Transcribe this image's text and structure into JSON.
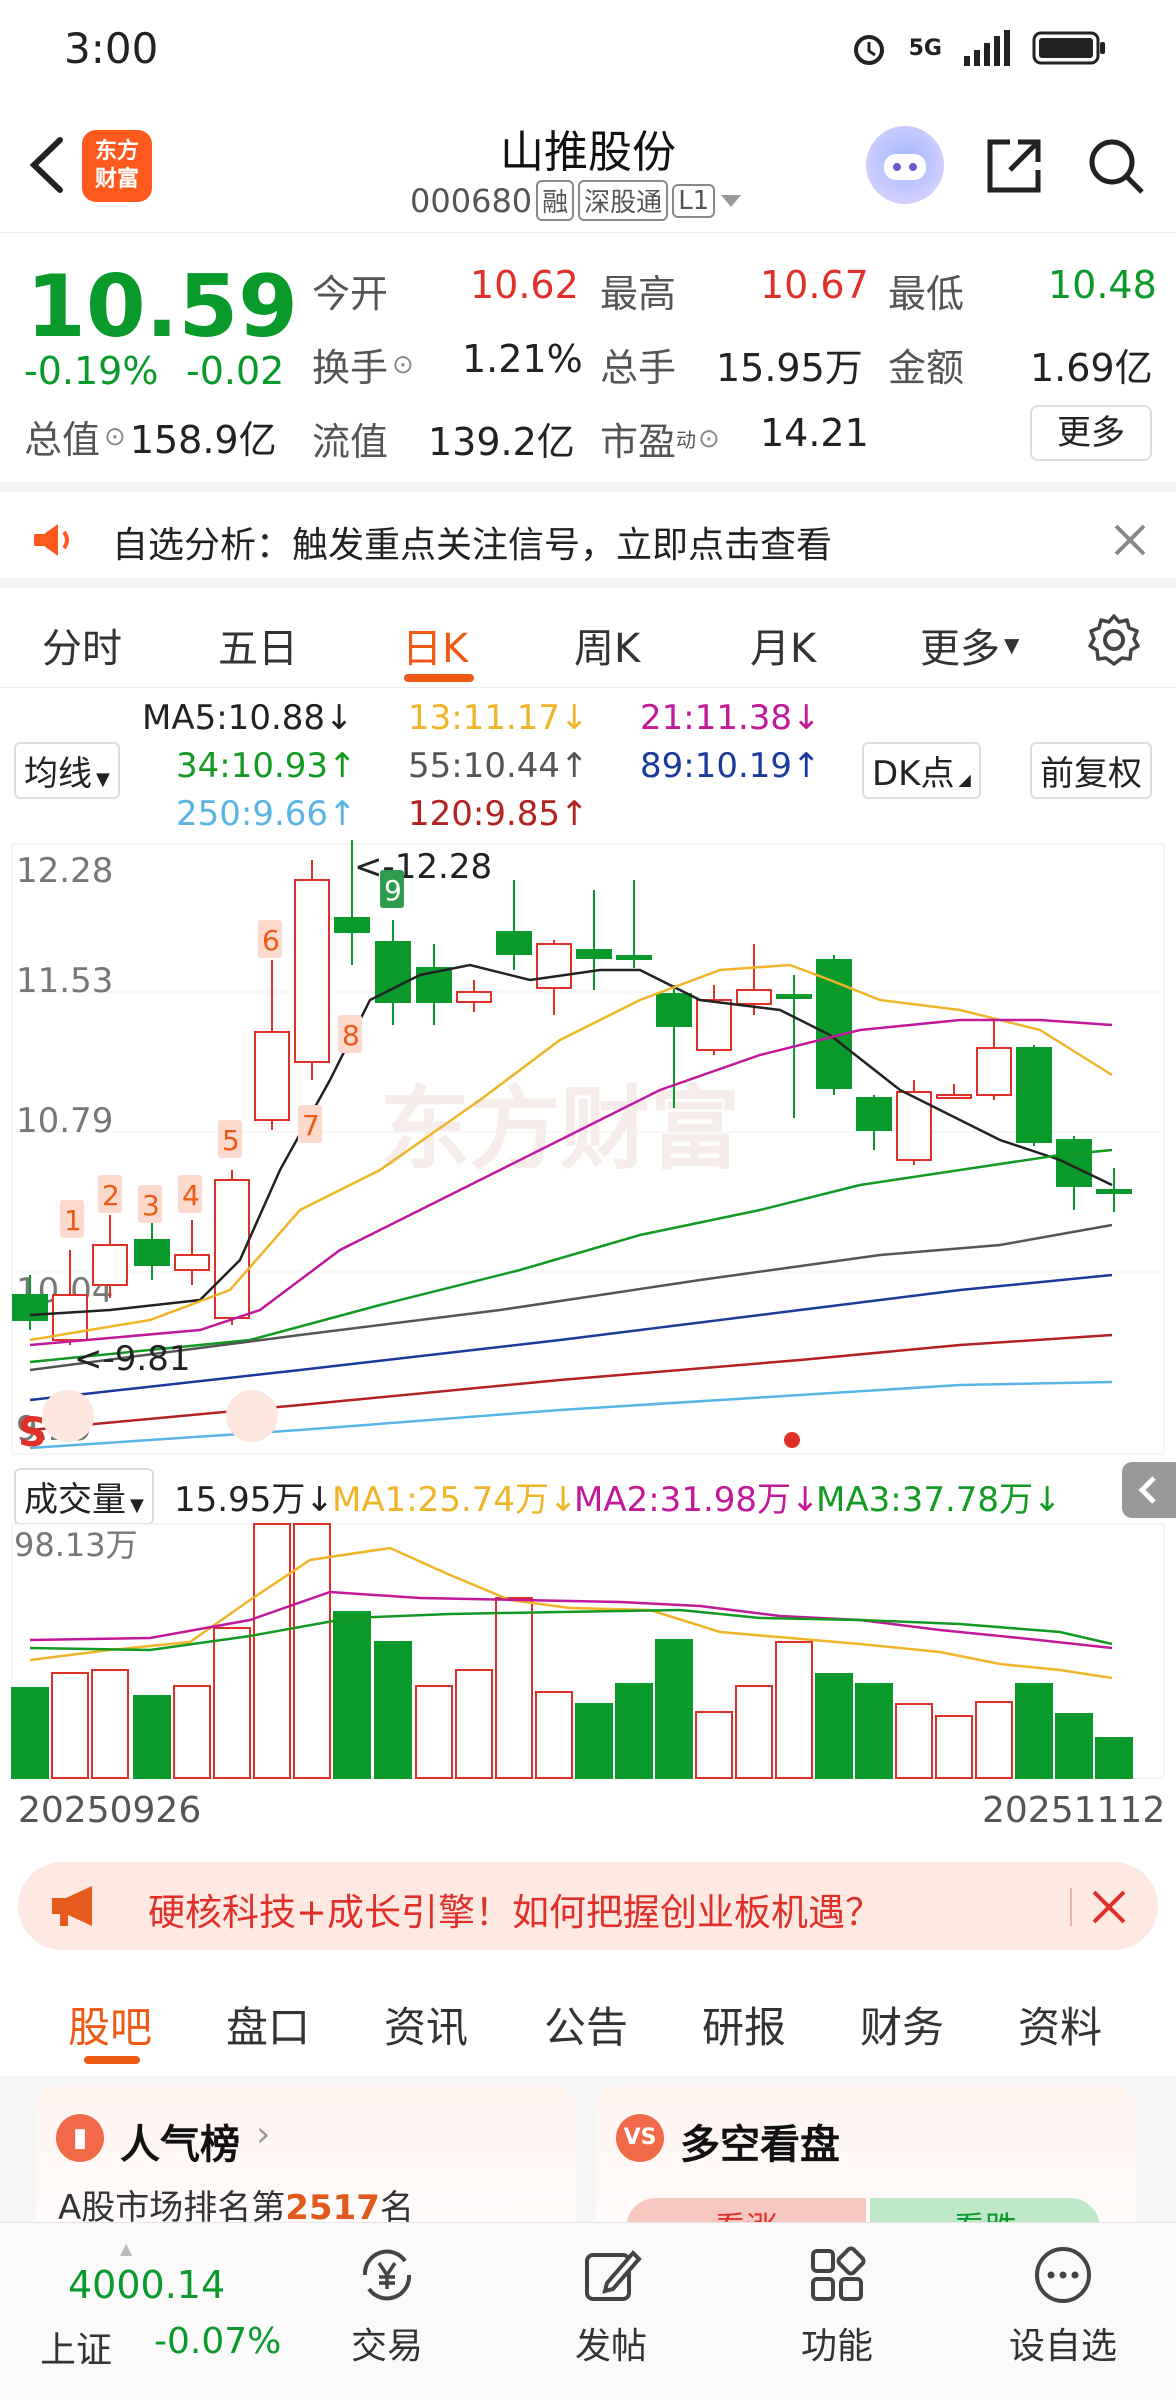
{
  "status": {
    "time": "3:00",
    "network": "5G"
  },
  "header": {
    "title": "山推股份",
    "code": "000680",
    "tags": [
      "融",
      "深股通",
      "L1"
    ],
    "logo_line1": "东方",
    "logo_line2": "财富"
  },
  "quote": {
    "price": "10.59",
    "change_pct": "-0.19%",
    "change": "-0.02",
    "open_label": "今开",
    "open": "10.62",
    "high_label": "最高",
    "high": "10.67",
    "low_label": "最低",
    "low": "10.48",
    "turnover_label": "换手",
    "turnover": "1.21%",
    "volume_label": "总手",
    "volume": "15.95万",
    "amount_label": "金额",
    "amount": "1.69亿",
    "mktcap_label": "总值",
    "mktcap": "158.9亿",
    "float_label": "流值",
    "float": "139.2亿",
    "pe_label": "市盈",
    "pe_sup": "动",
    "pe": "14.21",
    "more": "更多"
  },
  "banner": {
    "text": "自选分析：触发重点关注信号，立即点击查看"
  },
  "period_tabs": [
    "分时",
    "五日",
    "日K",
    "周K",
    "月K",
    "更多"
  ],
  "ma_legend": {
    "ma_button": "均线",
    "ma5": "MA5:10.88",
    "ma13": "13:11.17",
    "ma21": "21:11.38",
    "ma34": "34:10.93",
    "ma55": "55:10.44",
    "ma89": "89:10.19",
    "ma250": "250:9.66",
    "ma120": "120:9.85",
    "dk_button": "DK点",
    "adjust_button": "前复权",
    "colors": {
      "ma5": "#222222",
      "ma13": "#f0b429",
      "ma21": "#c2189a",
      "ma34": "#129a22",
      "ma55": "#555555",
      "ma89": "#1a3a9c",
      "ma250": "#5ab4e6",
      "ma120": "#b22222"
    }
  },
  "kchart": {
    "y_ticks": [
      "12.28",
      "11.53",
      "10.79",
      "10.04",
      "9.29"
    ],
    "max_label": "12.28",
    "min_label": "9.81",
    "markers": [
      "1",
      "2",
      "3",
      "4",
      "5",
      "6",
      "7",
      "8",
      "9"
    ],
    "watermark": "东方财富"
  },
  "volume": {
    "button": "成交量",
    "current": "15.95万",
    "ma1": "MA1:25.74万",
    "ma2": "MA2:31.98万",
    "ma3": "MA3:37.78万",
    "max_tick": "98.13万"
  },
  "dates": {
    "start": "20250926",
    "end": "20251112"
  },
  "promo": {
    "text": "硬核科技+成长引擎！如何把握创业板机遇？"
  },
  "info_tabs": [
    "股吧",
    "盘口",
    "资讯",
    "公告",
    "研报",
    "财务",
    "资料"
  ],
  "cards": {
    "left_title": "人气榜",
    "left_sub_prefix": "A股市场排名第",
    "left_rank": "2517",
    "left_sub_suffix": "名",
    "right_title": "多空看盘",
    "right_up": "看涨",
    "right_down": "看跌"
  },
  "bottom_nav": {
    "index_value": "4000.14",
    "index_name": "上证",
    "index_change": "-0.07%",
    "items": [
      "交易",
      "发帖",
      "功能",
      "设自选"
    ]
  }
}
